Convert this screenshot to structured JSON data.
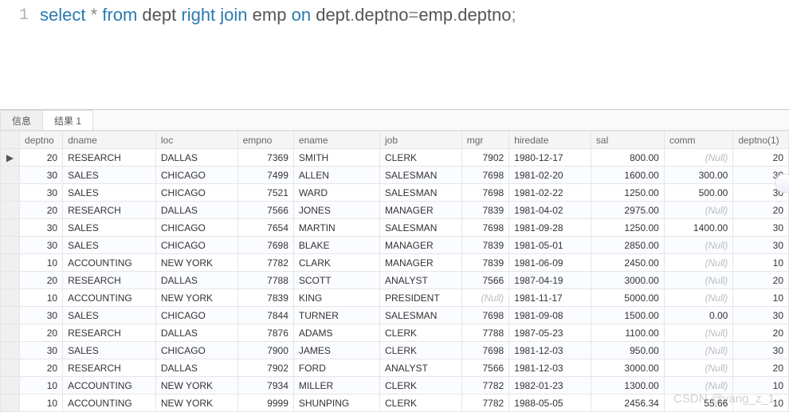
{
  "editor": {
    "line_no": "1",
    "tokens": [
      {
        "t": "select",
        "c": "kw"
      },
      {
        "t": " ",
        "c": ""
      },
      {
        "t": "*",
        "c": "star"
      },
      {
        "t": " ",
        "c": ""
      },
      {
        "t": "from",
        "c": "kw"
      },
      {
        "t": " ",
        "c": ""
      },
      {
        "t": "dept",
        "c": "id"
      },
      {
        "t": " ",
        "c": ""
      },
      {
        "t": "right",
        "c": "kw"
      },
      {
        "t": " ",
        "c": ""
      },
      {
        "t": "join",
        "c": "kw"
      },
      {
        "t": " ",
        "c": ""
      },
      {
        "t": "emp",
        "c": "id"
      },
      {
        "t": " ",
        "c": ""
      },
      {
        "t": "on",
        "c": "kw"
      },
      {
        "t": " ",
        "c": ""
      },
      {
        "t": "dept",
        "c": "id"
      },
      {
        "t": ".",
        "c": "op"
      },
      {
        "t": "deptno",
        "c": "id"
      },
      {
        "t": "=",
        "c": "op"
      },
      {
        "t": "emp",
        "c": "id"
      },
      {
        "t": ".",
        "c": "op"
      },
      {
        "t": "deptno",
        "c": "id"
      },
      {
        "t": ";",
        "c": "op"
      }
    ]
  },
  "tabs": {
    "info": "信息",
    "result": "结果 1",
    "active": "result"
  },
  "table": {
    "null_text": "(Null)",
    "columns": [
      {
        "key": "deptno",
        "label": "deptno",
        "cls": "c-deptno",
        "align": "num"
      },
      {
        "key": "dname",
        "label": "dname",
        "cls": "c-dname",
        "align": ""
      },
      {
        "key": "loc",
        "label": "loc",
        "cls": "c-loc",
        "align": ""
      },
      {
        "key": "empno",
        "label": "empno",
        "cls": "c-empno",
        "align": "num"
      },
      {
        "key": "ename",
        "label": "ename",
        "cls": "c-ename",
        "align": ""
      },
      {
        "key": "job",
        "label": "job",
        "cls": "c-job",
        "align": ""
      },
      {
        "key": "mgr",
        "label": "mgr",
        "cls": "c-mgr",
        "align": "num"
      },
      {
        "key": "hiredate",
        "label": "hiredate",
        "cls": "c-hiredate",
        "align": ""
      },
      {
        "key": "sal",
        "label": "sal",
        "cls": "c-sal",
        "align": "num"
      },
      {
        "key": "comm",
        "label": "comm",
        "cls": "c-comm",
        "align": "num"
      },
      {
        "key": "deptno1",
        "label": "deptno(1)",
        "cls": "c-deptno1",
        "align": "num"
      }
    ],
    "rows": [
      {
        "mark": "▶",
        "deptno": "20",
        "dname": "RESEARCH",
        "loc": "DALLAS",
        "empno": "7369",
        "ename": "SMITH",
        "job": "CLERK",
        "mgr": "7902",
        "hiredate": "1980-12-17",
        "sal": "800.00",
        "comm": null,
        "deptno1": "20"
      },
      {
        "mark": "",
        "deptno": "30",
        "dname": "SALES",
        "loc": "CHICAGO",
        "empno": "7499",
        "ename": "ALLEN",
        "job": "SALESMAN",
        "mgr": "7698",
        "hiredate": "1981-02-20",
        "sal": "1600.00",
        "comm": "300.00",
        "deptno1": "30"
      },
      {
        "mark": "",
        "deptno": "30",
        "dname": "SALES",
        "loc": "CHICAGO",
        "empno": "7521",
        "ename": "WARD",
        "job": "SALESMAN",
        "mgr": "7698",
        "hiredate": "1981-02-22",
        "sal": "1250.00",
        "comm": "500.00",
        "deptno1": "30"
      },
      {
        "mark": "",
        "deptno": "20",
        "dname": "RESEARCH",
        "loc": "DALLAS",
        "empno": "7566",
        "ename": "JONES",
        "job": "MANAGER",
        "mgr": "7839",
        "hiredate": "1981-04-02",
        "sal": "2975.00",
        "comm": null,
        "deptno1": "20"
      },
      {
        "mark": "",
        "deptno": "30",
        "dname": "SALES",
        "loc": "CHICAGO",
        "empno": "7654",
        "ename": "MARTIN",
        "job": "SALESMAN",
        "mgr": "7698",
        "hiredate": "1981-09-28",
        "sal": "1250.00",
        "comm": "1400.00",
        "deptno1": "30"
      },
      {
        "mark": "",
        "deptno": "30",
        "dname": "SALES",
        "loc": "CHICAGO",
        "empno": "7698",
        "ename": "BLAKE",
        "job": "MANAGER",
        "mgr": "7839",
        "hiredate": "1981-05-01",
        "sal": "2850.00",
        "comm": null,
        "deptno1": "30"
      },
      {
        "mark": "",
        "deptno": "10",
        "dname": "ACCOUNTING",
        "loc": "NEW YORK",
        "empno": "7782",
        "ename": "CLARK",
        "job": "MANAGER",
        "mgr": "7839",
        "hiredate": "1981-06-09",
        "sal": "2450.00",
        "comm": null,
        "deptno1": "10"
      },
      {
        "mark": "",
        "deptno": "20",
        "dname": "RESEARCH",
        "loc": "DALLAS",
        "empno": "7788",
        "ename": "SCOTT",
        "job": "ANALYST",
        "mgr": "7566",
        "hiredate": "1987-04-19",
        "sal": "3000.00",
        "comm": null,
        "deptno1": "20"
      },
      {
        "mark": "",
        "deptno": "10",
        "dname": "ACCOUNTING",
        "loc": "NEW YORK",
        "empno": "7839",
        "ename": "KING",
        "job": "PRESIDENT",
        "mgr": null,
        "hiredate": "1981-11-17",
        "sal": "5000.00",
        "comm": null,
        "deptno1": "10"
      },
      {
        "mark": "",
        "deptno": "30",
        "dname": "SALES",
        "loc": "CHICAGO",
        "empno": "7844",
        "ename": "TURNER",
        "job": "SALESMAN",
        "mgr": "7698",
        "hiredate": "1981-09-08",
        "sal": "1500.00",
        "comm": "0.00",
        "deptno1": "30"
      },
      {
        "mark": "",
        "deptno": "20",
        "dname": "RESEARCH",
        "loc": "DALLAS",
        "empno": "7876",
        "ename": "ADAMS",
        "job": "CLERK",
        "mgr": "7788",
        "hiredate": "1987-05-23",
        "sal": "1100.00",
        "comm": null,
        "deptno1": "20"
      },
      {
        "mark": "",
        "deptno": "30",
        "dname": "SALES",
        "loc": "CHICAGO",
        "empno": "7900",
        "ename": "JAMES",
        "job": "CLERK",
        "mgr": "7698",
        "hiredate": "1981-12-03",
        "sal": "950.00",
        "comm": null,
        "deptno1": "30"
      },
      {
        "mark": "",
        "deptno": "20",
        "dname": "RESEARCH",
        "loc": "DALLAS",
        "empno": "7902",
        "ename": "FORD",
        "job": "ANALYST",
        "mgr": "7566",
        "hiredate": "1981-12-03",
        "sal": "3000.00",
        "comm": null,
        "deptno1": "20"
      },
      {
        "mark": "",
        "deptno": "10",
        "dname": "ACCOUNTING",
        "loc": "NEW YORK",
        "empno": "7934",
        "ename": "MILLER",
        "job": "CLERK",
        "mgr": "7782",
        "hiredate": "1982-01-23",
        "sal": "1300.00",
        "comm": null,
        "deptno1": "10"
      },
      {
        "mark": "",
        "deptno": "10",
        "dname": "ACCOUNTING",
        "loc": "NEW YORK",
        "empno": "9999",
        "ename": "SHUNPING",
        "job": "CLERK",
        "mgr": "7782",
        "hiredate": "1988-05-05",
        "sal": "2456.34",
        "comm": "55.66",
        "deptno1": "10"
      }
    ]
  },
  "watermark": "CSDN @yang_z_1"
}
